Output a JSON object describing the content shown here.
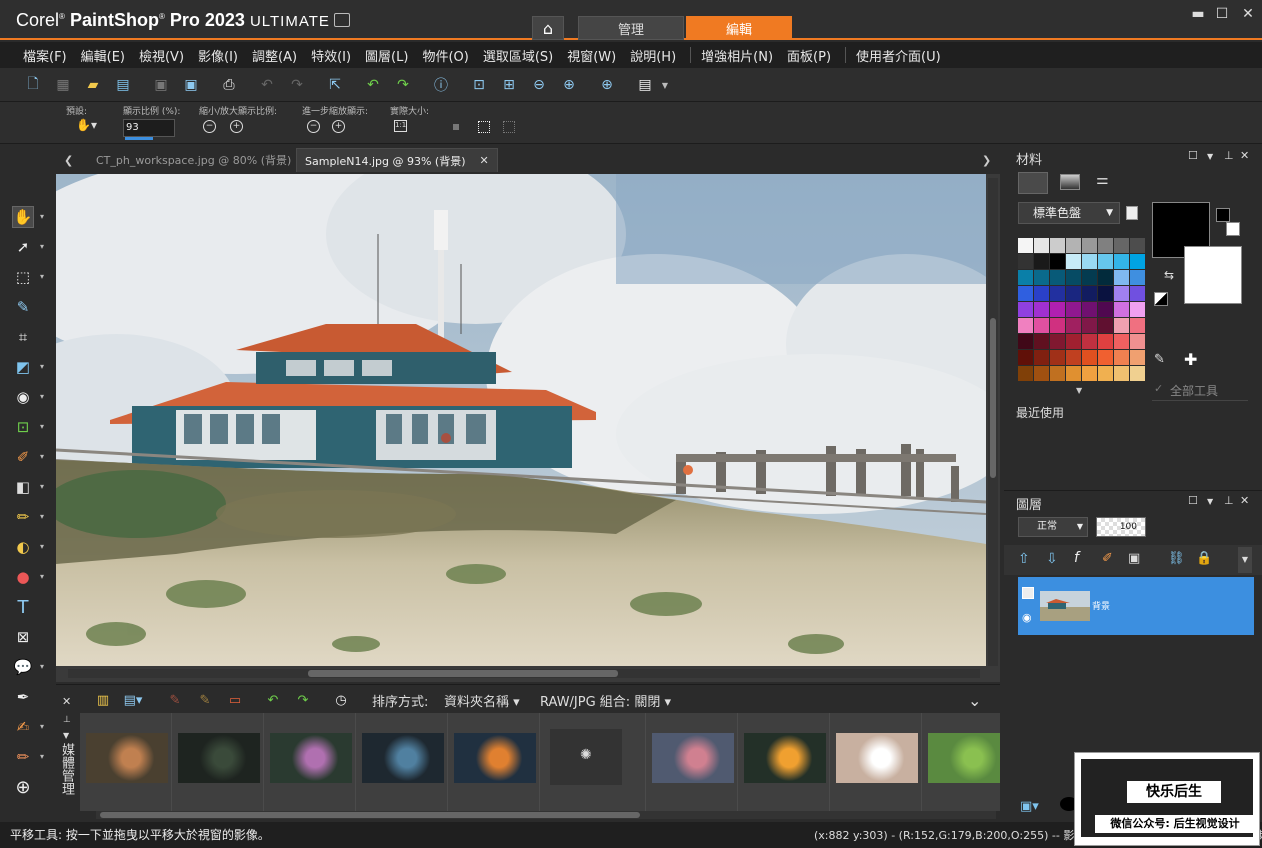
{
  "window": {
    "brand": "Corel",
    "product": "PaintShop",
    "pro_version": "Pro 2023",
    "edition": "ULTIMATE",
    "home_icon": "home-icon",
    "workspace_tabs": [
      "管理",
      "編輯"
    ],
    "active_workspace": "編輯",
    "controls": [
      "minimize-icon",
      "maximize-icon",
      "close-icon"
    ],
    "accent_color": "#f07a22"
  },
  "menu": [
    "檔案(F)",
    "編輯(E)",
    "檢視(V)",
    "影像(I)",
    "調整(A)",
    "特效(I)",
    "圖層(L)",
    "物件(O)",
    "選取區域(S)",
    "視窗(W)",
    "說明(H)",
    "增強相片(N)",
    "面板(P)",
    "使用者介面(U)"
  ],
  "options_bar": {
    "preset_label": "預設:",
    "zoom_label": "顯示比例 (%):",
    "zoom_value": "93",
    "zoom_inout_label": "縮小/放大顯示比例:",
    "step_zoom_label": "進一步縮放顯示:",
    "actual_size_label": "實際大小:"
  },
  "doc_tabs": [
    {
      "label": "CT_ph_workspace.jpg @  80% (背景)",
      "active": false
    },
    {
      "label": "SampleN14.jpg @  93% (背景)",
      "active": true
    }
  ],
  "organizer": {
    "side_label": "媒體管理",
    "sort_label": "排序方式:",
    "sort_value": "資料夾名稱",
    "raw_label": "RAW/JPG 組合: 關閉",
    "thumbnail_count": 10
  },
  "materials": {
    "title": "材料",
    "palette_select": "標準色盤",
    "all_tools": "全部工具",
    "recent": "最近使用",
    "foreground_color": "#000000",
    "background_color": "#ffffff"
  },
  "layers": {
    "title": "圖層",
    "blend_mode": "正常",
    "opacity": "100",
    "layer_name": "背景"
  },
  "status": {
    "message": "平移工具: 按一下並拖曳以平移大於視窗的影像。",
    "info": "(x:882 y:303) - (R:152,G:179,B:200,O:255) -- 影像:  1920 x 1080 x RGB - 8 位元/色頻"
  },
  "watermark": {
    "title": "快乐后生",
    "subtitle": "微信公众号: 后生视觉设计"
  }
}
